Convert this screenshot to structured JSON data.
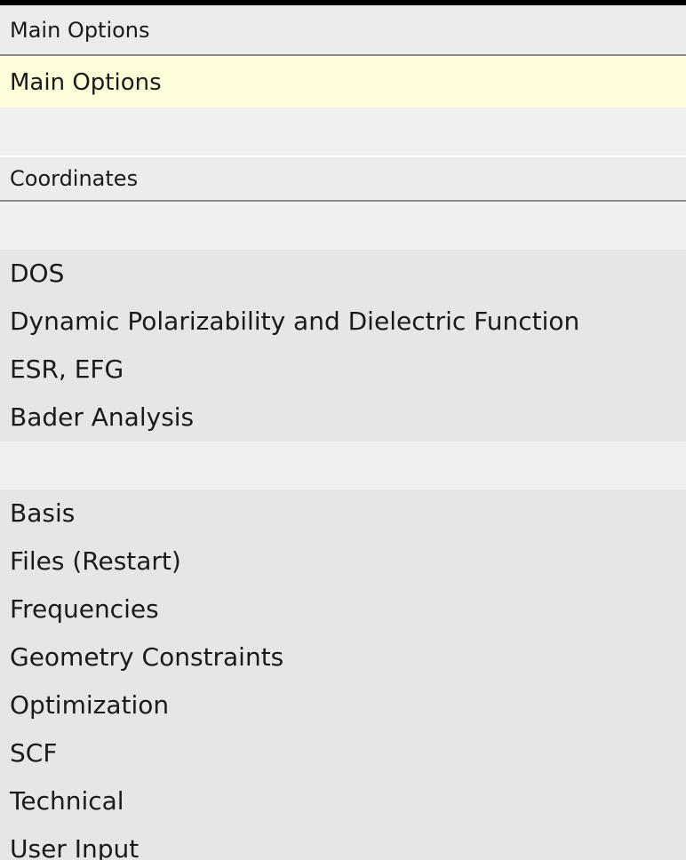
{
  "menu": {
    "section_main": "Main Options",
    "selected_item": "Main Options",
    "section_coordinates": "Coordinates",
    "group_properties": [
      "DOS",
      "Dynamic Polarizability and Dielectric Function",
      "ESR, EFG",
      "Bader Analysis"
    ],
    "group_details": [
      "Basis",
      "Files (Restart)",
      "Frequencies",
      "Geometry Constraints",
      "Optimization",
      "SCF",
      "Technical",
      "User Input"
    ]
  },
  "colors": {
    "selected_background": "#fefcd9",
    "menu_background": "#e6e6e6",
    "separator": "#8c8c8c"
  }
}
